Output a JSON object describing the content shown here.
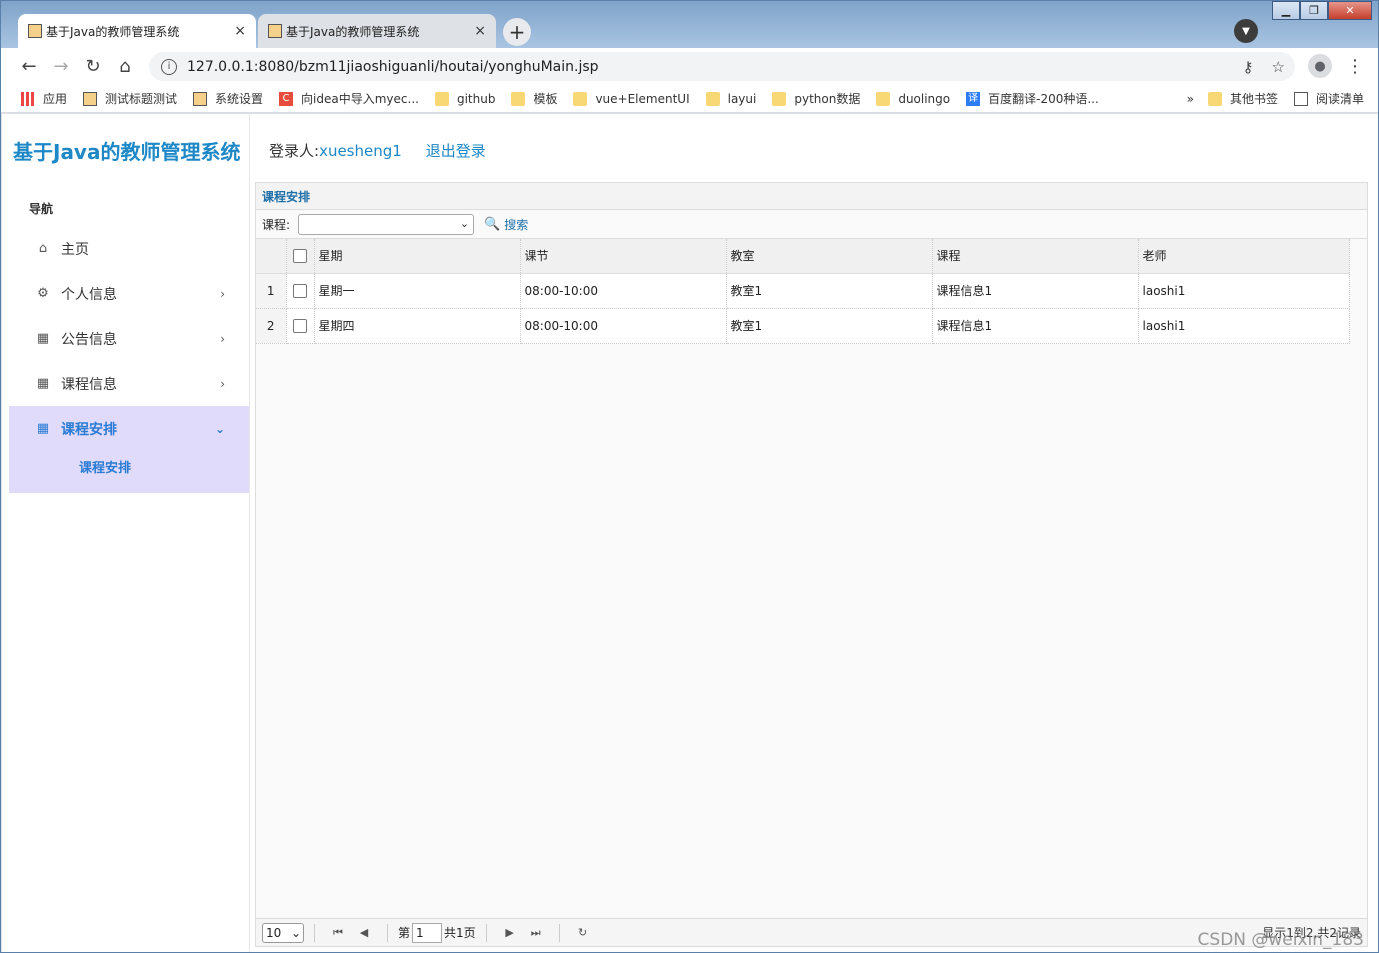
{
  "browser": {
    "tabs": [
      {
        "title": "基于Java的教师管理系统",
        "close": "×"
      },
      {
        "title": "基于Java的教师管理系统",
        "close": "×"
      }
    ],
    "newtab": "+",
    "url": "127.0.0.1:8080/bzm11jiaoshiguanli/houtai/yonghuMain.jsp",
    "bookmarks": [
      {
        "label": "应用",
        "icon": "apps-icon"
      },
      {
        "label": "测试标题测试",
        "icon": "page-icon"
      },
      {
        "label": "系统设置",
        "icon": "page-icon"
      },
      {
        "label": "向idea中导入myec...",
        "icon": "csdn-icon"
      },
      {
        "label": "github",
        "icon": "folder-icon"
      },
      {
        "label": "模板",
        "icon": "folder-icon"
      },
      {
        "label": "vue+ElementUI",
        "icon": "folder-icon"
      },
      {
        "label": "layui",
        "icon": "folder-icon"
      },
      {
        "label": "python数据",
        "icon": "folder-icon"
      },
      {
        "label": "duolingo",
        "icon": "folder-icon"
      },
      {
        "label": "百度翻译-200种语...",
        "icon": "translate-icon"
      }
    ],
    "more": "»",
    "other_bookmarks": "其他书签",
    "reading_list": "阅读清单"
  },
  "app": {
    "logo": "基于Java的教师管理系统",
    "nav_heading": "导航",
    "menu": [
      {
        "label": "主页",
        "icon": "home-icon"
      },
      {
        "label": "个人信息",
        "icon": "gear-icon"
      },
      {
        "label": "公告信息",
        "icon": "building-icon"
      },
      {
        "label": "课程信息",
        "icon": "building-icon"
      },
      {
        "label": "课程安排",
        "icon": "building-icon"
      }
    ],
    "submenu": "课程安排",
    "login_label": "登录人:",
    "username": "xuesheng1",
    "logout": "退出登录"
  },
  "panel": {
    "title": "课程安排",
    "filter_label": "课程:",
    "filter_value": "",
    "search": "搜索",
    "columns": [
      "星期",
      "课节",
      "教室",
      "课程",
      "老师"
    ],
    "rows": [
      {
        "n": "1",
        "cells": [
          "星期一",
          "08:00-10:00",
          "教室1",
          "课程信息1",
          "laoshi1"
        ]
      },
      {
        "n": "2",
        "cells": [
          "星期四",
          "08:00-10:00",
          "教室1",
          "课程信息1",
          "laoshi1"
        ]
      }
    ],
    "pager": {
      "page_size": "10",
      "page_prefix": "第",
      "page": "1",
      "page_suffix": "共1页",
      "info": "显示1到2,共2记录"
    }
  },
  "watermark": "CSDN @weixin_183"
}
